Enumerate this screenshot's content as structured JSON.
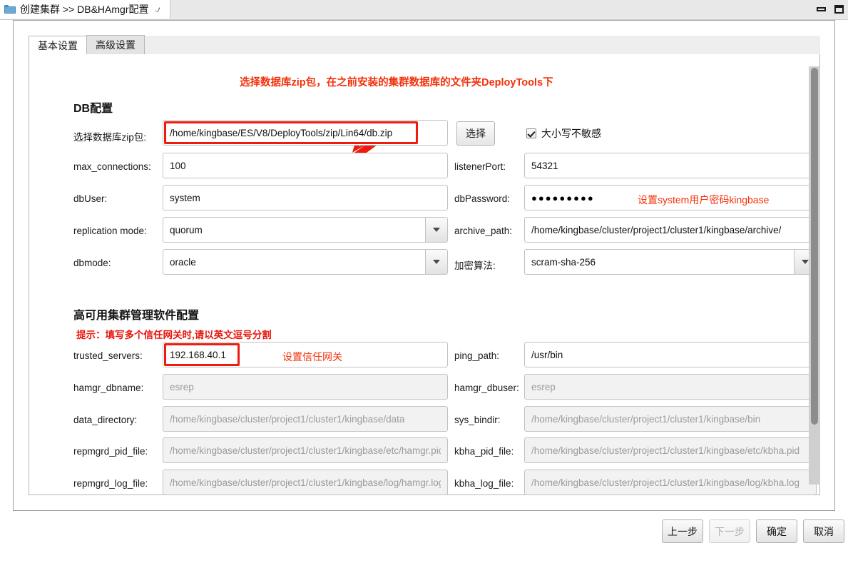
{
  "window": {
    "tab_title": "创建集群 >> DB&HAmgr配置",
    "tab_close_icon": "close-icon",
    "folder_icon": "folder-icon",
    "minimize_icon": "minimize-icon",
    "maximize_icon": "maximize-icon"
  },
  "tabs": [
    {
      "label": "基本设置",
      "active": true
    },
    {
      "label": "高级设置",
      "active": false
    }
  ],
  "annotations": {
    "zip_note": "选择数据库zip包，在之前安装的集群数据库的文件夹DeployTools下",
    "password_note": "设置system用户密码kingbase",
    "trusted_note": "设置信任网关",
    "trusted_hint": "提示：填写多个信任网关时,请以英文逗号分割",
    "arrow_icon": "red-arrow-icon",
    "accent_color": "#ef1b0e"
  },
  "db_section": {
    "title": "DB配置",
    "zip": {
      "label": "选择数据库zip包:",
      "value": "/home/kingbase/ES/V8/DeployTools/zip/Lin64/db.zip",
      "button": "选择"
    },
    "case_insensitive": {
      "label": "大小写不敏感",
      "checked": true
    },
    "max_connections": {
      "label": "max_connections:",
      "value": "100"
    },
    "listener_port": {
      "label": "listenerPort:",
      "value": "54321"
    },
    "db_user": {
      "label": "dbUser:",
      "value": "system"
    },
    "db_password": {
      "label": "dbPassword:",
      "value": "●●●●●●●●●"
    },
    "replication_mode": {
      "label": "replication mode:",
      "value": "quorum"
    },
    "archive_path": {
      "label": "archive_path:",
      "value": "/home/kingbase/cluster/project1/cluster1/kingbase/archive/"
    },
    "dbmode": {
      "label": "dbmode:",
      "value": "oracle"
    },
    "encrypt_algo": {
      "label": "加密算法:",
      "value": "scram-sha-256"
    }
  },
  "ha_section": {
    "title": "高可用集群管理软件配置",
    "trusted_servers": {
      "label": "trusted_servers:",
      "value": "192.168.40.1"
    },
    "ping_path": {
      "label": "ping_path:",
      "value": "/usr/bin"
    },
    "hamgr_dbname": {
      "label": "hamgr_dbname:",
      "value": "esrep",
      "disabled": true
    },
    "hamgr_dbuser": {
      "label": "hamgr_dbuser:",
      "value": "esrep",
      "disabled": true
    },
    "data_directory": {
      "label": "data_directory:",
      "value": "/home/kingbase/cluster/project1/cluster1/kingbase/data",
      "disabled": true
    },
    "sys_bindir": {
      "label": "sys_bindir:",
      "value": "/home/kingbase/cluster/project1/cluster1/kingbase/bin",
      "disabled": true
    },
    "repmgrd_pid_file": {
      "label": "repmgrd_pid_file:",
      "value": "/home/kingbase/cluster/project1/cluster1/kingbase/etc/hamgr.pid",
      "disabled": true
    },
    "kbha_pid_file": {
      "label": "kbha_pid_file:",
      "value": "/home/kingbase/cluster/project1/cluster1/kingbase/etc/kbha.pid",
      "disabled": true
    },
    "repmgrd_log_file": {
      "label": "repmgrd_log_file:",
      "value": "/home/kingbase/cluster/project1/cluster1/kingbase/log/hamgr.log",
      "disabled": true
    },
    "kbha_log_file": {
      "label": "kbha_log_file:",
      "value": "/home/kingbase/cluster/project1/cluster1/kingbase/log/kbha.log",
      "disabled": true
    }
  },
  "footer": {
    "prev": "上一步",
    "next": "下一步",
    "ok": "确定",
    "cancel": "取消",
    "next_disabled": true
  }
}
